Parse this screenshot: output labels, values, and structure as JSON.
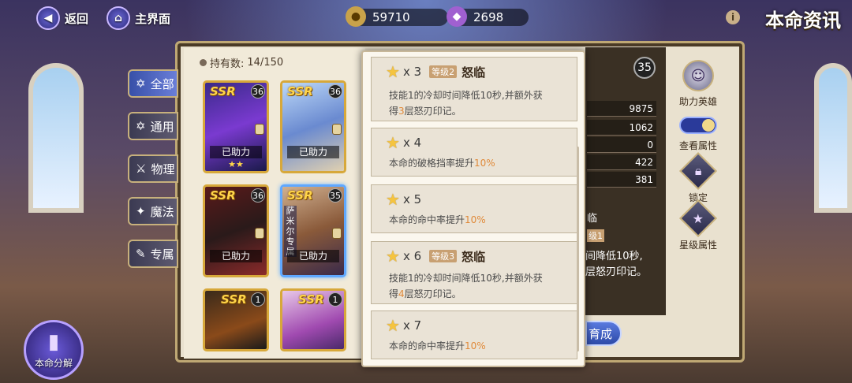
{
  "topbar": {
    "back_label": "返回",
    "main_label": "主界面",
    "gold": "59710",
    "gems": "2698",
    "title": "本命资讯"
  },
  "holding": {
    "label": "持有数:",
    "value": "14/150"
  },
  "tabs": [
    {
      "label": "全部",
      "active": true
    },
    {
      "label": "通用",
      "active": false
    },
    {
      "label": "物理",
      "active": false
    },
    {
      "label": "魔法",
      "active": false
    },
    {
      "label": "专属",
      "active": false
    }
  ],
  "cards": [
    {
      "rarity": "SSR",
      "level": "36",
      "status": "已助力",
      "stars": "★★"
    },
    {
      "rarity": "SSR",
      "level": "36",
      "status": "已助力",
      "stars": ""
    },
    {
      "rarity": "SSR",
      "level": "36",
      "status": "已助力",
      "stars": ""
    },
    {
      "rarity": "SSR",
      "level": "35",
      "status": "已助力",
      "stars": "",
      "tag": "萨米尔专属"
    },
    {
      "rarity": "SSR",
      "level": "1",
      "status": "",
      "stars": ""
    },
    {
      "rarity": "SSR",
      "level": "1",
      "status": "",
      "stars": ""
    }
  ],
  "hero_stats": [
    "9875",
    "1062",
    "0",
    "422",
    "381"
  ],
  "hero_level": "35",
  "side": {
    "assist_hero": "助力英雄",
    "view_attr": "查看属性",
    "lock": "锁定",
    "star_attr": "星级属性"
  },
  "bg_partial": {
    "name": "临",
    "grade": "级1",
    "line1": "间降低10秒,",
    "line2": "层怒刃印记。"
  },
  "popup": {
    "entries": [
      {
        "count": "x 3",
        "grade": "等级2",
        "name": "怒临",
        "desc_a": "技能1的冷却时间降低10秒,并额外获",
        "desc_b1": "得",
        "desc_hl": "3",
        "desc_b2": "层怒刃印记。"
      },
      {
        "count": "x 4",
        "desc_pre": "本命的破格挡率提升",
        "desc_hl": "10%"
      },
      {
        "count": "x 5",
        "desc_pre": "本命的命中率提升",
        "desc_hl": "10%"
      },
      {
        "count": "x 6",
        "grade": "等级3",
        "name": "怒临",
        "desc_a": "技能1的冷却时间降低10秒,并额外获",
        "desc_b1": "得",
        "desc_hl": "4",
        "desc_b2": "层怒刃印记。"
      },
      {
        "count": "x 7",
        "desc_pre": "本命的命中率提升",
        "desc_hl": "10%"
      }
    ]
  },
  "cultivate_label": "育成",
  "decompose_label": "本命分解"
}
